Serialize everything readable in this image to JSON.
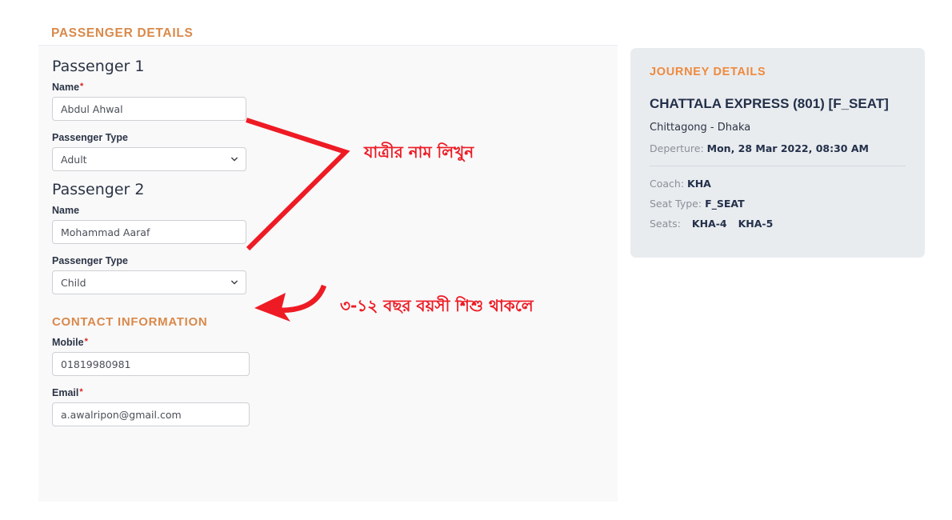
{
  "form": {
    "heading": "PASSENGER DETAILS",
    "passengers": [
      {
        "title": "Passenger 1",
        "name_label": "Name",
        "name_required": "*",
        "name_value": "Abdul Ahwal",
        "type_label": "Passenger Type",
        "type_value": "Adult",
        "type_options": [
          "Adult",
          "Child"
        ]
      },
      {
        "title": "Passenger 2",
        "name_label": "Name",
        "name_required": "",
        "name_value": "Mohammad Aaraf",
        "type_label": "Passenger Type",
        "type_value": "Child",
        "type_options": [
          "Adult",
          "Child"
        ]
      }
    ],
    "contact": {
      "heading": "CONTACT INFORMATION",
      "mobile_label": "Mobile",
      "mobile_required": "*",
      "mobile_value": "01819980981",
      "email_label": "Email",
      "email_required": "*",
      "email_value": "a.awalripon@gmail.com"
    }
  },
  "journey": {
    "heading": "JOURNEY DETAILS",
    "train": "CHATTALA EXPRESS (801) [F_SEAT]",
    "route": "Chittagong - Dhaka",
    "departure_label": "Deperture:",
    "departure_value": "Mon, 28 Mar 2022, 08:30 AM",
    "coach_label": "Coach:",
    "coach_value": "KHA",
    "seat_type_label": "Seat Type:",
    "seat_type_value": "F_SEAT",
    "seats_label": "Seats:",
    "seats": [
      "KHA-4",
      "KHA-5"
    ]
  },
  "annotations": {
    "name_note": "যাত্রীর নাম লিখুন",
    "child_note": "৩-১২ বছর বয়সী শিশু থাকলে"
  },
  "colors": {
    "heading_orange": "#d9894a",
    "journey_orange": "#ee8a3e",
    "annotation_red": "#ee1b24",
    "panel_bg": "#f9f9fa",
    "card_bg": "#e9ecef",
    "text_navy": "#23304a"
  },
  "icons": {
    "chevron": "chevron-down-icon"
  }
}
